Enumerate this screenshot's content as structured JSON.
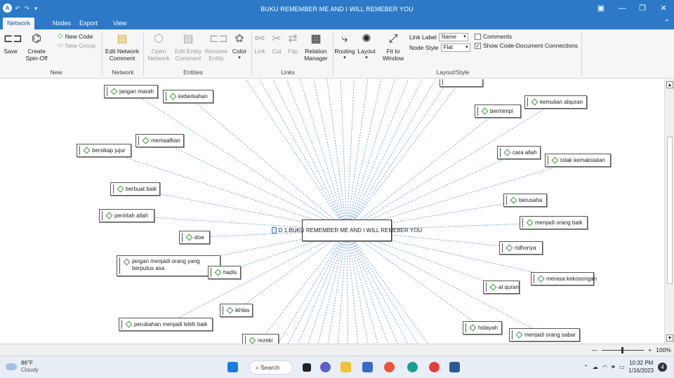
{
  "window": {
    "title": "BUKU REMEMBER ME AND I WILL REMEBER YOU",
    "controls": {
      "minimize": "—",
      "restore": "❐",
      "close": "✕",
      "extra": "▣"
    }
  },
  "ribbon_tabs": [
    "Network",
    "Nodes",
    "Export",
    "View"
  ],
  "ribbon": {
    "new_group": {
      "label": "New",
      "save": "Save",
      "create_spin_off": "Create Spin-Off",
      "new_code": "New Code",
      "new_group": "New Group"
    },
    "network_group": {
      "label": "Network",
      "edit_network_comment": "Edit Network Comment"
    },
    "entities_group": {
      "label": "Entities",
      "open_network": "Open Network",
      "edit_entity_comment": "Edit Entity Comment",
      "rename_entity": "Rename Entity",
      "color": "Color"
    },
    "links_group": {
      "label": "Links",
      "link": "Link",
      "cut": "Cut",
      "flip": "Flip",
      "relation_manager": "Relation Manager"
    },
    "layout_group": {
      "label": "Layout/Style",
      "routing": "Routing",
      "layout": "Layout",
      "fit_to_window": "Fit to Window",
      "link_label": "Link Label",
      "link_label_value": "Name",
      "node_style": "Node Style",
      "node_style_value": "Flat",
      "comments": "Comments",
      "comments_checked": false,
      "show_connections": "Show Code-Document Connections",
      "show_connections_checked": true
    }
  },
  "network": {
    "center": "D 1:BUKU REMEMBER ME AND I WILL REMEBER YOU",
    "codes": [
      "jangan marah",
      "keberkahan",
      "memaafkan",
      "bersikap jujur",
      "berbuat baik",
      "perintah allah",
      "doa",
      "jangan menjadi orang yang berputus asa",
      "hadis",
      "ikhlas",
      "perubahan menjadi lebih baik",
      "rezeki",
      "bermimpi",
      "kemulian alquran",
      "cara allah",
      "tolak kemaksiatan",
      "berusaha",
      "menjadi orang baik",
      "ridhonya",
      "merasa kekosongan",
      "al quran",
      "hidayah",
      "menjadi orang sabar"
    ]
  },
  "statusbar": {
    "zoom": "100%",
    "zoom_level": 1.0
  },
  "taskbar": {
    "weather_temp": "86°F",
    "weather_desc": "Cloudy",
    "search": "Search",
    "time": "10:32 PM",
    "date": "1/16/2023",
    "notifications": "4"
  }
}
